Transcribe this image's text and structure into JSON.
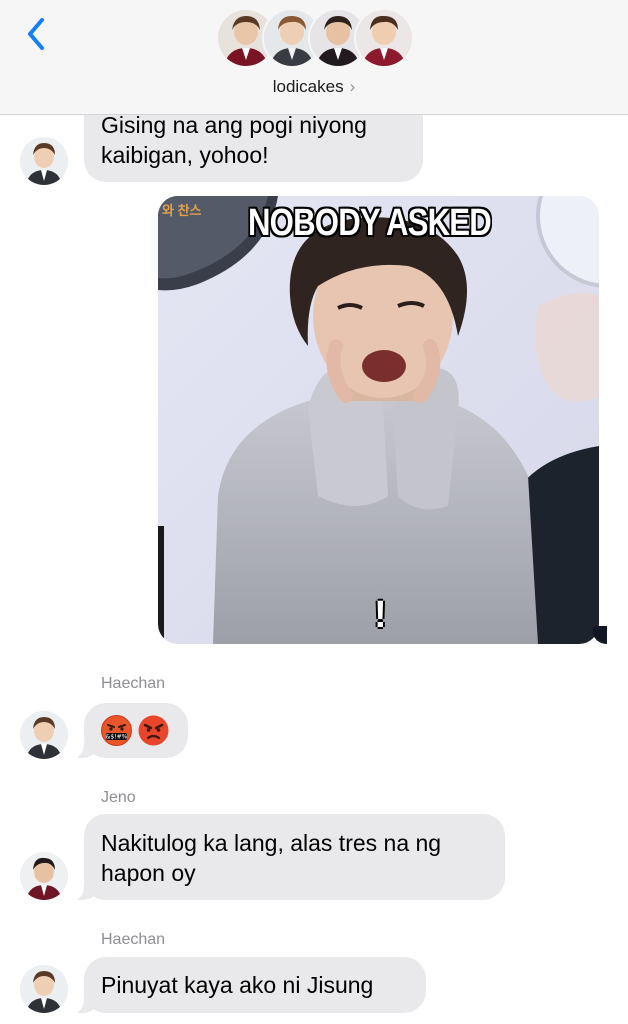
{
  "header": {
    "group_name": "lodicakes",
    "chevron": "›",
    "back_icon": "chevron-left-icon",
    "accent_color": "#157efb"
  },
  "meme": {
    "caption": "NOBODY ASKED",
    "exclaim": "!",
    "watermark": "와 찬스"
  },
  "messages": [
    {
      "sender": "",
      "text_lines": [
        "Gising na ang pogi niyong",
        "kaibigan, yohoo!"
      ]
    },
    {
      "sender": "Haechan",
      "emojis": [
        "swearing-face-emoji",
        "angry-face-emoji"
      ]
    },
    {
      "sender": "Jeno",
      "text_lines": [
        "Nakitulog ka lang, alas tres na ng",
        "hapon oy"
      ]
    },
    {
      "sender": "Haechan",
      "text_lines": [
        "Pinuyat kaya ako ni Jisung"
      ]
    }
  ],
  "colors": {
    "bubble_gray": "#e9e9eb",
    "header_bg": "#f6f6f6",
    "secondary_text": "#8e8e93"
  }
}
